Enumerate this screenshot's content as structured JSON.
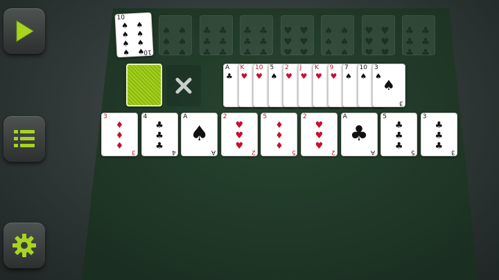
{
  "sidebar": {
    "play_icon": "play-icon",
    "menu_icon": "list-icon",
    "settings_icon": "gear-icon"
  },
  "colors": {
    "accent": "#9ccf1a",
    "felt": "#23402c",
    "red": "#c8102e"
  },
  "top_card": {
    "rank": "10",
    "suit": "♠",
    "color": "black"
  },
  "ghost_slots": [
    {
      "rank": "",
      "suit": "♠"
    },
    {
      "rank": "",
      "suit": "♣"
    },
    {
      "rank": "",
      "suit": "♣"
    },
    {
      "rank": "",
      "suit": "♥"
    },
    {
      "rank": "",
      "suit": "♠"
    },
    {
      "rank": "",
      "suit": "♥"
    },
    {
      "rank": "",
      "suit": "♣"
    }
  ],
  "waste_fan": [
    {
      "rank": "A",
      "suit": "♣",
      "color": "black"
    },
    {
      "rank": "K",
      "suit": "♥",
      "color": "red"
    },
    {
      "rank": "10",
      "suit": "♥",
      "color": "red"
    },
    {
      "rank": "5",
      "suit": "♠",
      "color": "black"
    },
    {
      "rank": "2",
      "suit": "♥",
      "color": "red"
    },
    {
      "rank": "J",
      "suit": "♥",
      "color": "red"
    },
    {
      "rank": "K",
      "suit": "♥",
      "color": "red"
    },
    {
      "rank": "9",
      "suit": "♥",
      "color": "red"
    },
    {
      "rank": "7",
      "suit": "♠",
      "color": "black"
    },
    {
      "rank": "10",
      "suit": "♠",
      "color": "black"
    },
    {
      "rank": "3",
      "suit": "♠",
      "color": "black"
    }
  ],
  "tableau": [
    {
      "rank": "3",
      "suit": "♦",
      "color": "red"
    },
    {
      "rank": "4",
      "suit": "♣",
      "color": "black"
    },
    {
      "rank": "A",
      "suit": "♠",
      "color": "black"
    },
    {
      "rank": "2",
      "suit": "♥",
      "color": "red"
    },
    {
      "rank": "5",
      "suit": "♦",
      "color": "red"
    },
    {
      "rank": "2",
      "suit": "♥",
      "color": "red"
    },
    {
      "rank": "A",
      "suit": "♣",
      "color": "black"
    },
    {
      "rank": "5",
      "suit": "♣",
      "color": "black"
    },
    {
      "rank": "3",
      "suit": "♣",
      "color": "black"
    }
  ],
  "cancel_icon": "close-icon"
}
